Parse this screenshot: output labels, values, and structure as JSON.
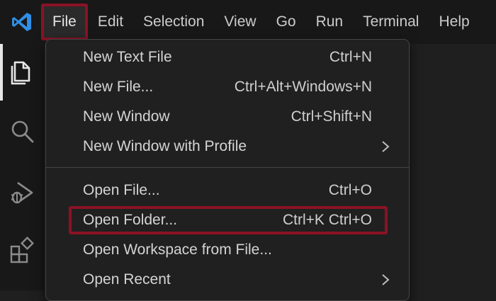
{
  "menubar": {
    "items": [
      {
        "label": "File"
      },
      {
        "label": "Edit"
      },
      {
        "label": "Selection"
      },
      {
        "label": "View"
      },
      {
        "label": "Go"
      },
      {
        "label": "Run"
      },
      {
        "label": "Terminal"
      },
      {
        "label": "Help"
      }
    ]
  },
  "activitybar": {
    "icons": [
      "explorer-icon",
      "search-icon",
      "run-debug-icon",
      "extensions-icon"
    ]
  },
  "file_menu": {
    "items": [
      {
        "label": "New Text File",
        "shortcut": "Ctrl+N"
      },
      {
        "label": "New File...",
        "shortcut": "Ctrl+Alt+Windows+N"
      },
      {
        "label": "New Window",
        "shortcut": "Ctrl+Shift+N"
      },
      {
        "label": "New Window with Profile",
        "shortcut": ""
      },
      {
        "label": "Open File...",
        "shortcut": "Ctrl+O"
      },
      {
        "label": "Open Folder...",
        "shortcut": "Ctrl+K Ctrl+O"
      },
      {
        "label": "Open Workspace from File...",
        "shortcut": ""
      },
      {
        "label": "Open Recent",
        "shortcut": ""
      }
    ]
  },
  "colors": {
    "highlight": "#8b1225",
    "vscode_blue": "#2f8fe6",
    "menu_bg": "#202020"
  }
}
